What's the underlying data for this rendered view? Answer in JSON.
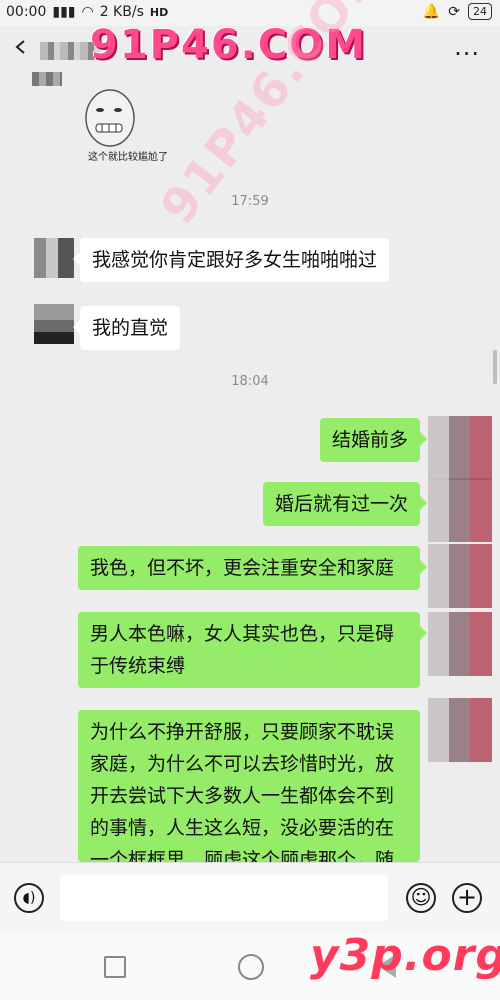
{
  "status_bar": {
    "time": "00:00",
    "speed": "2 KB/s",
    "hd": "HD",
    "battery": "24"
  },
  "watermarks": {
    "top": "91P46.COM",
    "diagonal": "91P46.COM",
    "bottom": "y3p.org"
  },
  "sticker": {
    "caption": "这个就比较尴尬了"
  },
  "messages": [
    {
      "type": "time",
      "text": "17:59"
    },
    {
      "type": "left",
      "text": "我感觉你肯定跟好多女生啪啪啪过"
    },
    {
      "type": "left",
      "text": "我的直觉"
    },
    {
      "type": "time",
      "text": "18:04"
    },
    {
      "type": "right",
      "text": "结婚前多"
    },
    {
      "type": "right",
      "text": "婚后就有过一次"
    },
    {
      "type": "right",
      "text": "我色，但不坏，更会注重安全和家庭"
    },
    {
      "type": "right",
      "text": "男人本色嘛，女人其实也色，只是碍于传统束缚"
    },
    {
      "type": "right",
      "text": "为什么不挣开舒服，只要顾家不耽误家庭，为什么不可以去珍惜时光，放开去尝试下大多数人一生都体会不到的事情，人生这么短，没必要活的在一个框框里，顾虑这个顾虑那个，随"
    }
  ],
  "colors": {
    "bubble_right": "#95ec69",
    "bubble_left": "#ffffff",
    "chat_bg": "#ededed"
  },
  "icons": {
    "voice": "voice-icon",
    "emoji": "emoji-icon",
    "plus": "plus-icon",
    "more": "more-icon",
    "back": "back-icon"
  }
}
